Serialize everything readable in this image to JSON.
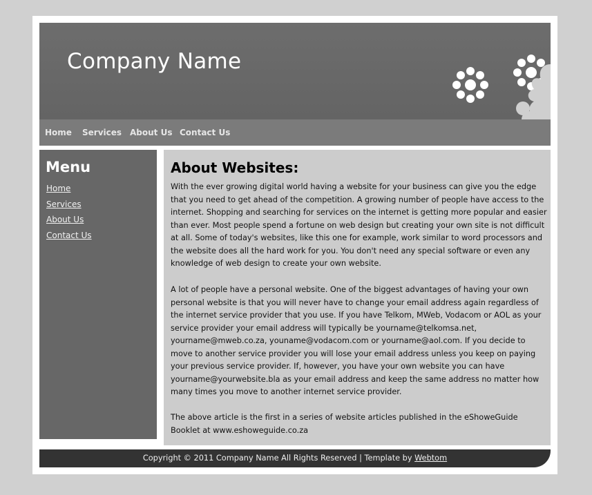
{
  "header": {
    "site_title": "Company Name"
  },
  "nav": {
    "items": [
      {
        "label": "Home"
      },
      {
        "label": "Services"
      },
      {
        "label": "About Us"
      },
      {
        "label": "Contact Us"
      }
    ]
  },
  "sidebar": {
    "heading": "Menu",
    "links": [
      {
        "label": "Home"
      },
      {
        "label": "Services"
      },
      {
        "label": "About Us"
      },
      {
        "label": "Contact Us"
      }
    ]
  },
  "main": {
    "heading": "About Websites:",
    "paragraphs": [
      "With the ever growing digital world having a website for your business can give you the edge that you need to get ahead of the competition. A growing number of people have access to the internet. Shopping and searching for services on the internet is getting more popular and easier than ever. Most people spend a fortune on web design but creating your own site is not difficult at all. Some of today's websites, like this one for example, work similar to word processors and the website does all the hard work for you. You don't need any special software or even any knowledge of web design to create your own website.",
      "A lot of people have a personal website. One of the biggest advantages of having your own personal website is that you will never have to change your email address again regardless of the internet service provider that you use. If you have Telkom, MWeb, Vodacom or AOL as your service provider your email address will typically be yourname@telkomsa.net, yourname@mweb.co.za, youname@vodacom.com or yourname@aol.com. If you decide to move to another service provider you will lose your email address unless you keep on paying your previous service provider. If, however, you have your own website you can have yourname@yourwebsite.bla as your email address and keep the same address no matter how many times you move to another internet service provider.",
      "The above article is the first in a series of website articles published in the eShoweGuide Booklet at www.eshoweguide.co.za"
    ]
  },
  "footer": {
    "copyright": "Copyright © 2011 Company Name All Rights Reserved |  Template by ",
    "credit_link": "Webtom"
  },
  "colors": {
    "page_bg": "#d0d0d0",
    "header_bg": "#666666",
    "nav_bg": "#7b7b7b",
    "sidebar_bg": "#676767",
    "content_bg": "#cccccc",
    "footer_bg": "#333333"
  }
}
